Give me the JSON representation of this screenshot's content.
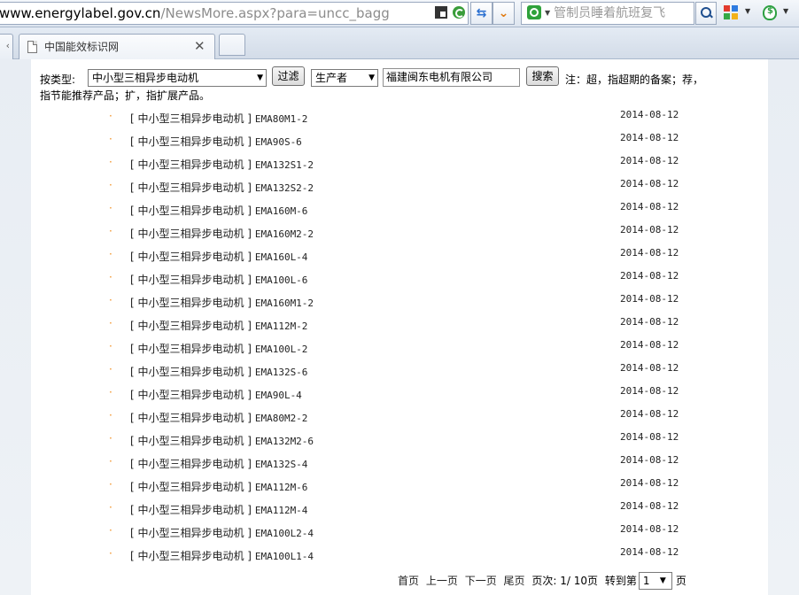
{
  "browser": {
    "url_host": "www.energylabel.gov.cn",
    "url_path": "/NewsMore.aspx?para=uncc_bagg",
    "search_placeholder": "管制员睡着航班复飞",
    "tab_title": "中国能效标识网"
  },
  "filter": {
    "type_label": "按类型:",
    "type_value": "中小型三相异步电动机",
    "filter_button": "过滤",
    "field_value": "生产者",
    "company_value": "福建闽东电机有限公司",
    "search_button": "搜索",
    "note_line1": "注：超，指超期的备案；荐，",
    "note_line2": "指节能推荐产品；扩，指扩展产品。"
  },
  "items": [
    {
      "category": "[ 中小型三相异步电动机 ]",
      "model": "EMA80M1-2",
      "date": "2014-08-12"
    },
    {
      "category": "[ 中小型三相异步电动机 ]",
      "model": "EMA90S-6",
      "date": "2014-08-12"
    },
    {
      "category": "[ 中小型三相异步电动机 ]",
      "model": "EMA132S1-2",
      "date": "2014-08-12"
    },
    {
      "category": "[ 中小型三相异步电动机 ]",
      "model": "EMA132S2-2",
      "date": "2014-08-12"
    },
    {
      "category": "[ 中小型三相异步电动机 ]",
      "model": "EMA160M-6",
      "date": "2014-08-12"
    },
    {
      "category": "[ 中小型三相异步电动机 ]",
      "model": "EMA160M2-2",
      "date": "2014-08-12"
    },
    {
      "category": "[ 中小型三相异步电动机 ]",
      "model": "EMA160L-4",
      "date": "2014-08-12"
    },
    {
      "category": "[ 中小型三相异步电动机 ]",
      "model": "EMA100L-6",
      "date": "2014-08-12"
    },
    {
      "category": "[ 中小型三相异步电动机 ]",
      "model": "EMA160M1-2",
      "date": "2014-08-12"
    },
    {
      "category": "[ 中小型三相异步电动机 ]",
      "model": "EMA112M-2",
      "date": "2014-08-12"
    },
    {
      "category": "[ 中小型三相异步电动机 ]",
      "model": "EMA100L-2",
      "date": "2014-08-12"
    },
    {
      "category": "[ 中小型三相异步电动机 ]",
      "model": "EMA132S-6",
      "date": "2014-08-12"
    },
    {
      "category": "[ 中小型三相异步电动机 ]",
      "model": "EMA90L-4",
      "date": "2014-08-12"
    },
    {
      "category": "[ 中小型三相异步电动机 ]",
      "model": "EMA80M2-2",
      "date": "2014-08-12"
    },
    {
      "category": "[ 中小型三相异步电动机 ]",
      "model": "EMA132M2-6",
      "date": "2014-08-12"
    },
    {
      "category": "[ 中小型三相异步电动机 ]",
      "model": "EMA132S-4",
      "date": "2014-08-12"
    },
    {
      "category": "[ 中小型三相异步电动机 ]",
      "model": "EMA112M-6",
      "date": "2014-08-12"
    },
    {
      "category": "[ 中小型三相异步电动机 ]",
      "model": "EMA112M-4",
      "date": "2014-08-12"
    },
    {
      "category": "[ 中小型三相异步电动机 ]",
      "model": "EMA100L2-4",
      "date": "2014-08-12"
    },
    {
      "category": "[ 中小型三相异步电动机 ]",
      "model": "EMA100L1-4",
      "date": "2014-08-12"
    }
  ],
  "pager": {
    "first": "首页",
    "prev": "上一页",
    "next": "下一页",
    "last": "尾页",
    "page_info": "页次: 1/ 10页",
    "goto_label": "转到第",
    "goto_value": "1",
    "page_suffix": "页"
  }
}
